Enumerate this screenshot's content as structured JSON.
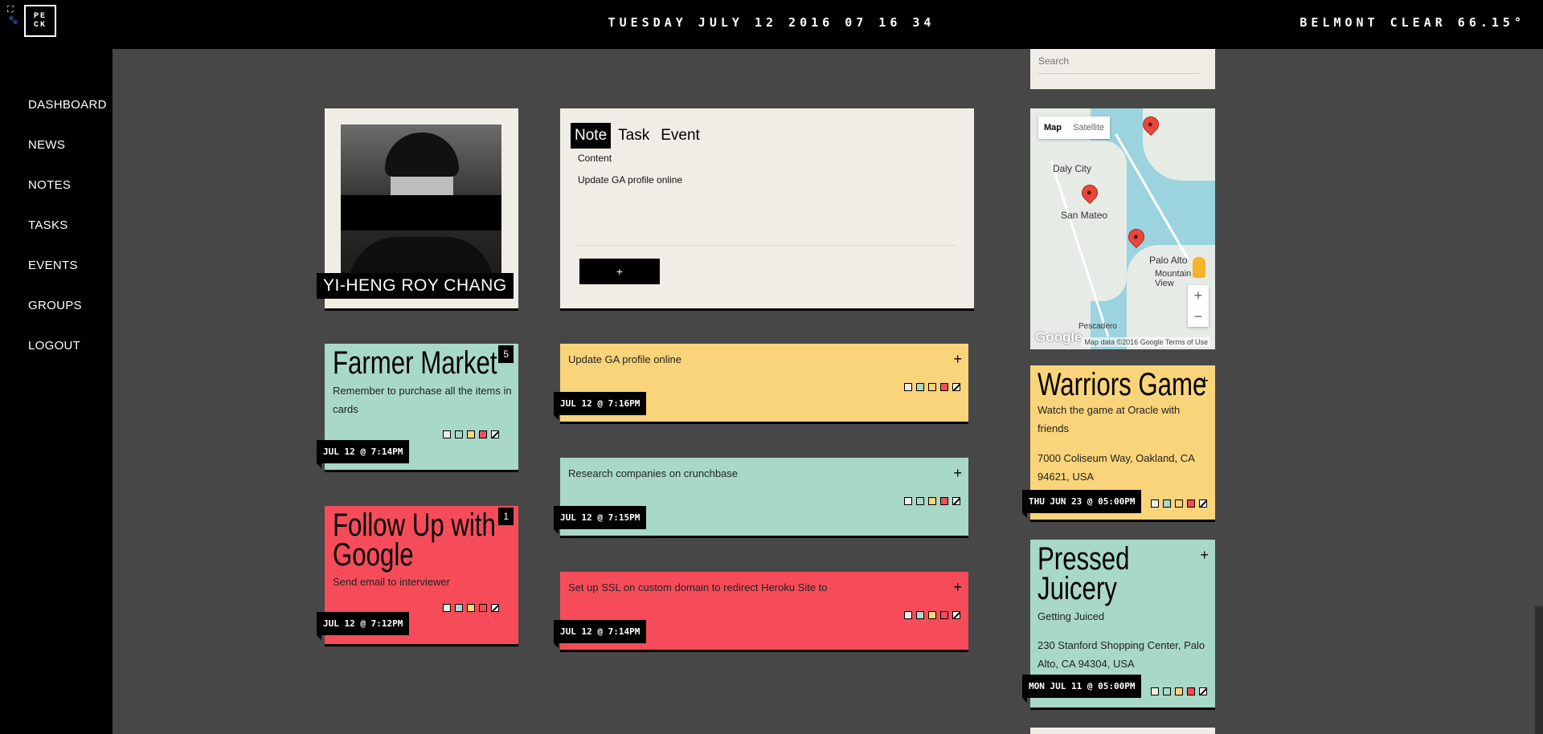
{
  "topbar": {
    "logo": "PE\nCK",
    "logo_line1": "PE",
    "logo_line2": "CK",
    "datetime": "TUESDAY JULY 12 2016 07 16 34",
    "weather": "BELMONT CLEAR 66.15°",
    "expand_icon": "expand-icon",
    "dog_icon": "dog-icon"
  },
  "nav": [
    "DASHBOARD",
    "NEWS",
    "NOTES",
    "TASKS",
    "EVENTS",
    "GROUPS",
    "LOGOUT"
  ],
  "profile": {
    "name": "YI-HENG ROY CHANG"
  },
  "composer": {
    "tabs": [
      "Note",
      "Task",
      "Event"
    ],
    "active_tab": "Note",
    "content_label": "Content",
    "content_value": "Update GA profile online",
    "add_label": "+"
  },
  "notes": [
    {
      "title": "Farmer Market",
      "description": "Remember to purchase all the items in cards",
      "count": "5",
      "date": "JUL 12 @ 7:14PM",
      "color": "#a8d8c8"
    },
    {
      "title_lines": [
        "Follow Up with",
        "Google"
      ],
      "description": "Send email to interviewer",
      "count": "1",
      "date": "JUL 12 @ 7:12PM",
      "color": "#f64c5a"
    }
  ],
  "tasks": [
    {
      "text": "Update GA profile online",
      "date": "JUL 12 @ 7:16PM",
      "color": "#f9d47a"
    },
    {
      "text": "Research companies on crunchbase",
      "date": "JUL 12 @ 7:15PM",
      "color": "#a8d8c8"
    },
    {
      "text": "Set up SSL on custom domain to redirect Heroku Site to",
      "date": "JUL 12 @ 7:14PM",
      "color": "#f64c5a"
    }
  ],
  "search": {
    "placeholder": "Search"
  },
  "map": {
    "buttons": [
      "Map",
      "Satellite"
    ],
    "labels": [
      "Daly City",
      "San Mateo",
      "Palo Alto",
      "Mountain View",
      "Pescadero"
    ],
    "footer": "Map data ©2016 Google",
    "terms": "Terms of Use",
    "google": "Google"
  },
  "events": [
    {
      "title": "Warriors Game",
      "description": "Watch the game at Oracle with friends",
      "address": "7000 Coliseum Way, Oakland, CA 94621, USA",
      "date": "THU JUN 23 @ 05:00PM",
      "color": "#f9d47a"
    },
    {
      "title_lines": [
        "Pressed",
        "Juicery"
      ],
      "description": "Getting Juiced",
      "address": "230 Stanford Shopping Center, Palo Alto, CA 94304, USA",
      "date": "MON JUL 11 @ 05:00PM",
      "color": "#a8d8c8"
    }
  ],
  "swatch_colors": [
    "#f0ede7",
    "#a8d8c8",
    "#f9d47a",
    "#f64c5a"
  ],
  "plus": "+",
  "zoom": {
    "in": "+",
    "out": "−"
  }
}
